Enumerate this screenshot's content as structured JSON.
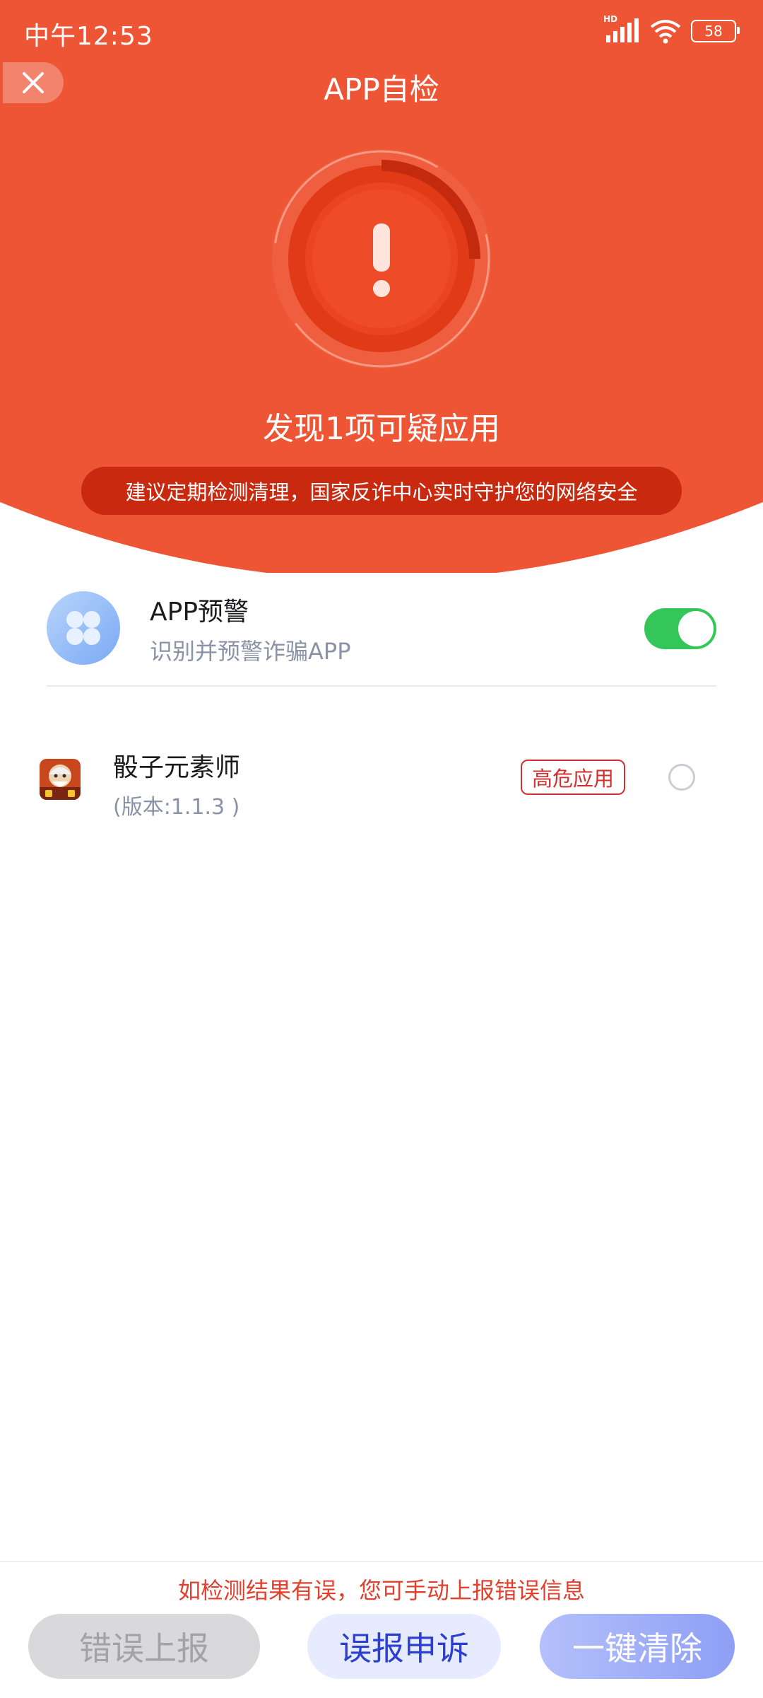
{
  "status_bar": {
    "time": "中午12:53",
    "network_badge": "HD",
    "battery": "58",
    "icons": [
      "signal-icon",
      "wifi-icon",
      "battery-icon"
    ]
  },
  "header": {
    "close_icon": "close-icon",
    "title": "APP自检",
    "alert_icon": "exclamation-alert-icon",
    "found_text": "发现1项可疑应用",
    "tip": "建议定期检测清理，国家反诈中心实时守护您的网络安全",
    "colors": {
      "background": "#ee5535",
      "pill": "#c8290f"
    }
  },
  "warning": {
    "icon": "four-petal-app-icon",
    "title": "APP预警",
    "subtitle": "识别并预警诈骗APP",
    "toggle_on": true,
    "toggle_color": "#35c659"
  },
  "apps": [
    {
      "name": "骰子元素师",
      "version": "(版本:1.1.3 )",
      "risk_label": "高危应用",
      "selected": false
    }
  ],
  "bottom": {
    "hint": "如检测结果有误，您可手动上报错误信息",
    "report_button": "错误上报",
    "appeal_button": "误报申诉",
    "clear_button": "一键清除"
  }
}
